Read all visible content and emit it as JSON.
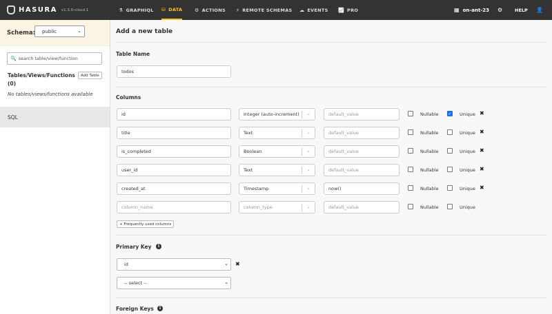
{
  "app": {
    "name": "HASURA",
    "version": "v1.3.0-cloud.1"
  },
  "nav": {
    "items": [
      {
        "label": "GRAPHIQL",
        "icon": "flask-icon",
        "active": false
      },
      {
        "label": "DATA",
        "icon": "database-icon",
        "active": true
      },
      {
        "label": "ACTIONS",
        "icon": "cogs-icon",
        "active": false
      },
      {
        "label": "REMOTE SCHEMAS",
        "icon": "plug-icon",
        "active": false
      },
      {
        "label": "EVENTS",
        "icon": "cloud-icon",
        "active": false
      },
      {
        "label": "PRO",
        "icon": "chart-line-icon",
        "active": false
      }
    ],
    "project": "on-ant-23",
    "help": "HELP"
  },
  "sidebar": {
    "schema_label": "Schema:",
    "schema_value": "public",
    "search_placeholder": "search table/view/function",
    "tables_heading": "Tables/Views/Functions (0)",
    "add_table": "Add Table",
    "empty_text": "No tables/views/functions available",
    "sql_link": "SQL"
  },
  "main": {
    "title": "Add a new table",
    "table_name_label": "Table Name",
    "table_name_value": "todos",
    "columns_label": "Columns",
    "columns": [
      {
        "name": "id",
        "type": "Integer (auto-increment)",
        "default": "",
        "nullable": false,
        "unique": true,
        "removable": true
      },
      {
        "name": "title",
        "type": "Text",
        "default": "",
        "nullable": false,
        "unique": false,
        "removable": true
      },
      {
        "name": "is_completed",
        "type": "Boolean",
        "default": "",
        "nullable": false,
        "unique": false,
        "removable": true
      },
      {
        "name": "user_id",
        "type": "Text",
        "default": "",
        "nullable": false,
        "unique": false,
        "removable": true
      },
      {
        "name": "created_at",
        "type": "Timestamp",
        "default": "now()",
        "nullable": false,
        "unique": false,
        "removable": true
      },
      {
        "name": "",
        "type": "",
        "default": "",
        "nullable": false,
        "unique": false,
        "removable": false
      }
    ],
    "placeholders": {
      "column_name": "column_name",
      "column_type": "column_type",
      "default_value": "default_value"
    },
    "nullable_label": "Nullable",
    "unique_label": "Unique",
    "frequent_columns_button": "+ Frequently used columns",
    "primary_key_label": "Primary Key",
    "primary_key_value": "id",
    "primary_key_select_placeholder": "-- select --",
    "foreign_keys_label": "Foreign Keys"
  },
  "colors": {
    "topbar": "#333333",
    "accent": "#ffc627",
    "schema_bg": "#fcf5e4"
  }
}
